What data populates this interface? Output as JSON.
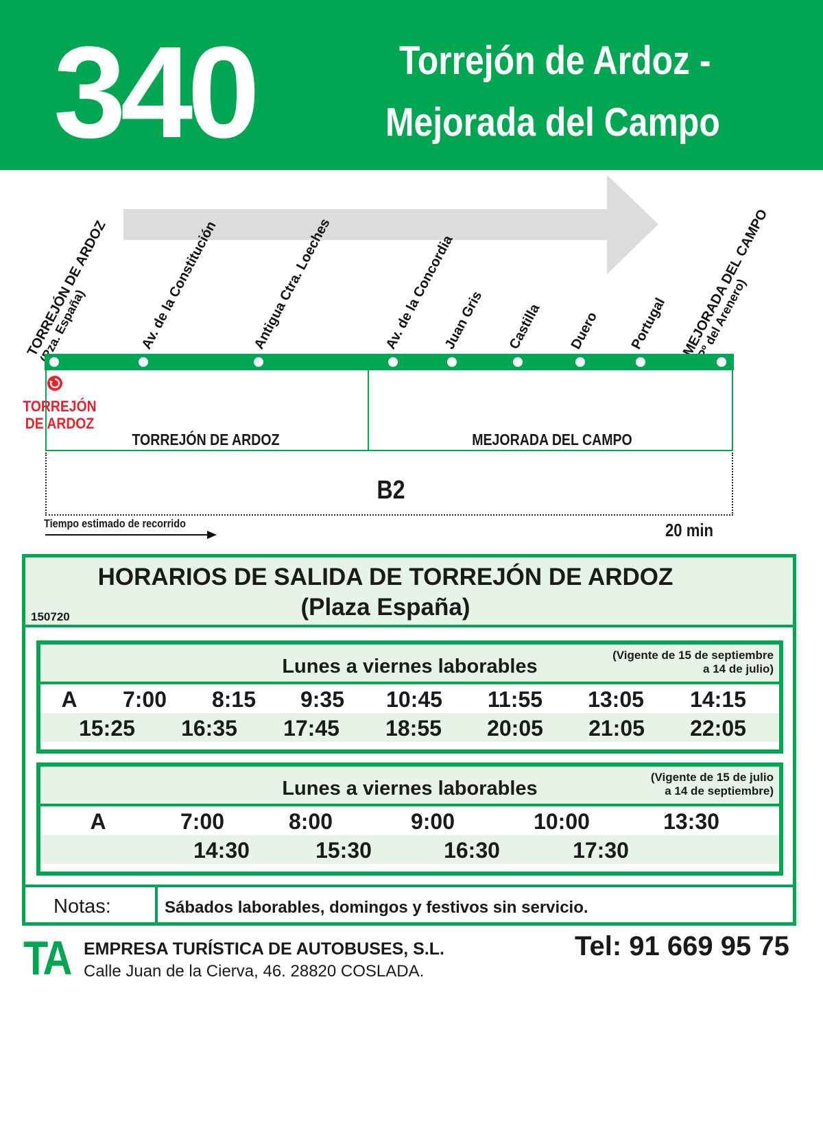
{
  "header": {
    "route_number": "340",
    "route_name_line1": "Torrejón de Ardoz -",
    "route_name_line2": "Mejorada del Campo"
  },
  "diagram": {
    "stops": [
      {
        "name": "TORREJÓN DE ARDOZ",
        "sub": "(Pza. España)"
      },
      {
        "name": "Av. de la Constitución",
        "sub": ""
      },
      {
        "name": "Antigua Ctra. Loeches",
        "sub": ""
      },
      {
        "name": "Av. de la Concordia",
        "sub": ""
      },
      {
        "name": "Juan Gris",
        "sub": ""
      },
      {
        "name": "Castilla",
        "sub": ""
      },
      {
        "name": "Duero",
        "sub": ""
      },
      {
        "name": "Portugal",
        "sub": ""
      },
      {
        "name": "MEJORADA DEL CAMPO",
        "sub": "(Pº del Arenero)"
      }
    ],
    "origin_marker": {
      "line1": "TORREJÓN",
      "line2": "DE ARDOZ",
      "color": "#e8222a"
    },
    "zones": [
      "TORREJÓN DE ARDOZ",
      "MEJORADA DEL CAMPO"
    ],
    "tariff_zone": "B2",
    "travel_time_label": "Tiempo estimado de recorrido",
    "travel_time_value": "20 min"
  },
  "timetable": {
    "title_line1": "HORARIOS DE SALIDA DE TORREJÓN DE ARDOZ",
    "title_line2": "(Plaza España)",
    "code": "150720",
    "panels": [
      {
        "title": "Lunes a viernes laborables",
        "validity_line1": "(Vigente de 15 de septiembre",
        "validity_line2": "a 14 de julio)",
        "row1": [
          "A",
          "7:00",
          "8:15",
          "9:35",
          "10:45",
          "11:55",
          "13:05",
          "14:15"
        ],
        "row2": [
          "15:25",
          "16:35",
          "17:45",
          "18:55",
          "20:05",
          "21:05",
          "22:05"
        ]
      },
      {
        "title": "Lunes a viernes laborables",
        "validity_line1": "(Vigente de 15 de julio",
        "validity_line2": "a 14 de septiembre)",
        "row1": [
          "A",
          "7:00",
          "8:00",
          "9:00",
          "10:00",
          "13:30"
        ],
        "row2": [
          "14:30",
          "15:30",
          "16:30",
          "17:30"
        ]
      }
    ],
    "notes_label": "Notas:",
    "notes_text": "Sábados laborables, domingos y festivos sin servicio."
  },
  "footer": {
    "logo": "TA",
    "company_name": "EMPRESA TURÍSTICA DE AUTOBUSES, S.L.",
    "company_address": "Calle Juan de la Cierva, 46. 28820 COSLADA.",
    "phone": "Tel: 91 669 95 75"
  },
  "colors": {
    "brand_green": "#00a651",
    "light_green": "#e7f3e6",
    "accent_red": "#e8222a"
  }
}
